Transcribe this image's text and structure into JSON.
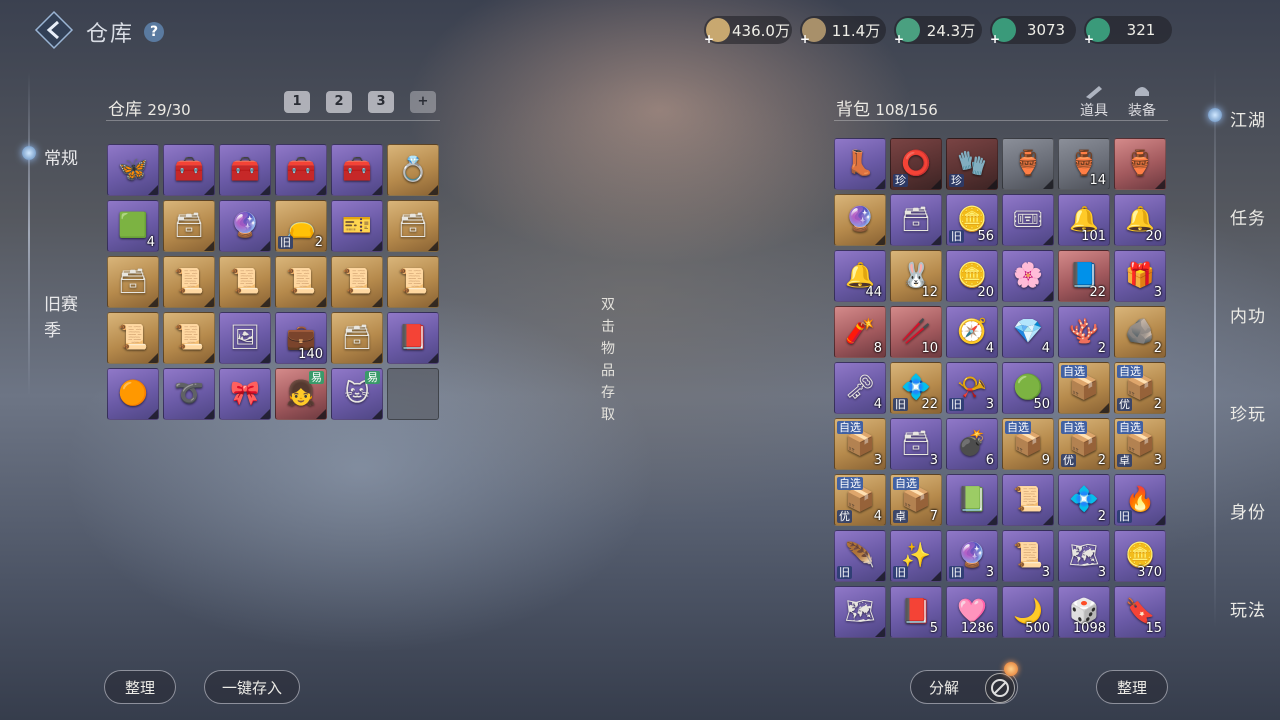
{
  "header": {
    "title": "仓库",
    "help_icon": "question-icon"
  },
  "currencies": [
    {
      "name": "scroll-currency-icon",
      "value": "436.0万",
      "color": "#c8a870"
    },
    {
      "name": "coin-currency-icon",
      "value": "11.4万",
      "color": "#a8906a"
    },
    {
      "name": "jade-currency-icon",
      "value": "24.3万",
      "color": "#4aa080"
    },
    {
      "name": "jade-gem-icon",
      "value": "3073",
      "color": "#3a9a7a"
    },
    {
      "name": "jade-token-icon",
      "value": "321",
      "color": "#3a9a7a"
    }
  ],
  "left_tabs": {
    "normal": "常规",
    "season": "旧赛季"
  },
  "warehouse": {
    "label": "仓库",
    "used": "29",
    "capacity": "30",
    "tabs": [
      "1",
      "2",
      "3",
      "+"
    ],
    "items": [
      {
        "rarity": "purple",
        "icon": "butterfly-icon",
        "glyph": "🦋",
        "qty": ""
      },
      {
        "rarity": "purple",
        "icon": "box-icon",
        "glyph": "🧰",
        "qty": ""
      },
      {
        "rarity": "purple",
        "icon": "box-icon",
        "glyph": "🧰",
        "qty": ""
      },
      {
        "rarity": "purple",
        "icon": "box-icon",
        "glyph": "🧰",
        "qty": ""
      },
      {
        "rarity": "purple",
        "icon": "box-icon",
        "glyph": "🧰",
        "qty": ""
      },
      {
        "rarity": "gold",
        "icon": "jade-ring-icon",
        "glyph": "💍",
        "qty": ""
      },
      {
        "rarity": "purple",
        "icon": "jade-block-icon",
        "glyph": "🟩",
        "qty": "4"
      },
      {
        "rarity": "gold",
        "icon": "chest-icon",
        "glyph": "🗃",
        "qty": ""
      },
      {
        "rarity": "purple",
        "icon": "orb-icon",
        "glyph": "🔮",
        "qty": ""
      },
      {
        "rarity": "gold",
        "icon": "pouch-icon",
        "glyph": "👝",
        "qty": "2",
        "tag": "旧"
      },
      {
        "rarity": "purple",
        "icon": "ticket-icon",
        "glyph": "🎫",
        "qty": ""
      },
      {
        "rarity": "gold",
        "icon": "chest-icon",
        "glyph": "🗃",
        "qty": ""
      },
      {
        "rarity": "gold",
        "icon": "chest-icon",
        "glyph": "🗃",
        "qty": ""
      },
      {
        "rarity": "gold",
        "icon": "parchment-icon",
        "glyph": "📜",
        "qty": ""
      },
      {
        "rarity": "gold",
        "icon": "parchment-icon",
        "glyph": "📜",
        "qty": ""
      },
      {
        "rarity": "gold",
        "icon": "parchment-icon",
        "glyph": "📜",
        "qty": ""
      },
      {
        "rarity": "gold",
        "icon": "parchment-icon",
        "glyph": "📜",
        "qty": ""
      },
      {
        "rarity": "gold",
        "icon": "parchment-icon",
        "glyph": "📜",
        "qty": ""
      },
      {
        "rarity": "gold",
        "icon": "parchment-icon",
        "glyph": "📜",
        "qty": ""
      },
      {
        "rarity": "gold",
        "icon": "parchment-icon",
        "glyph": "📜",
        "qty": ""
      },
      {
        "rarity": "purple",
        "icon": "photo-card-icon",
        "glyph": "🖼",
        "qty": ""
      },
      {
        "rarity": "purple",
        "icon": "treasure-chest-icon",
        "glyph": "💼",
        "qty": "140"
      },
      {
        "rarity": "gold",
        "icon": "chest-icon",
        "glyph": "🗃",
        "qty": ""
      },
      {
        "rarity": "purple",
        "icon": "red-box-icon",
        "glyph": "📕",
        "qty": ""
      },
      {
        "rarity": "purple",
        "icon": "amber-icon",
        "glyph": "🟠",
        "qty": ""
      },
      {
        "rarity": "purple",
        "icon": "red-cord-icon",
        "glyph": "➰",
        "qty": ""
      },
      {
        "rarity": "purple",
        "icon": "ribbon-icon",
        "glyph": "🎀",
        "qty": ""
      },
      {
        "rarity": "red",
        "icon": "character-portrait-icon",
        "glyph": "👧",
        "qty": "",
        "easy": "易"
      },
      {
        "rarity": "purple",
        "icon": "cat-portrait-icon",
        "glyph": "🐱",
        "qty": "",
        "easy": "易"
      },
      {
        "rarity": "empty",
        "icon": "empty-slot",
        "glyph": "",
        "qty": ""
      }
    ]
  },
  "hint": "双击物品存取",
  "backpack": {
    "label": "背包",
    "used": "108",
    "capacity": "156",
    "tabs": [
      {
        "label": "道具",
        "icon": "props-icon"
      },
      {
        "label": "装备",
        "icon": "equipment-icon"
      }
    ],
    "items": [
      {
        "rarity": "purple",
        "icon": "boots-icon",
        "glyph": "👢",
        "qty": ""
      },
      {
        "rarity": "darkred",
        "icon": "bracelet-icon",
        "glyph": "⭕",
        "qty": "",
        "tag": "珍"
      },
      {
        "rarity": "darkred",
        "icon": "gauntlet-icon",
        "glyph": "🧤",
        "qty": "",
        "tag": "珍"
      },
      {
        "rarity": "gray",
        "icon": "jar-icon",
        "glyph": "🏺",
        "qty": ""
      },
      {
        "rarity": "gray",
        "icon": "jar-icon",
        "glyph": "🏺",
        "qty": "14"
      },
      {
        "rarity": "red",
        "icon": "vase-icon",
        "glyph": "🏺",
        "qty": ""
      },
      {
        "rarity": "gold",
        "icon": "crystal-ball-icon",
        "glyph": "🔮",
        "qty": ""
      },
      {
        "rarity": "purple",
        "icon": "chest-icon",
        "glyph": "🗃",
        "qty": ""
      },
      {
        "rarity": "purple",
        "icon": "gold-ingot-icon",
        "glyph": "🪙",
        "qty": "56",
        "tag": "旧"
      },
      {
        "rarity": "purple",
        "icon": "gold-ticket-icon",
        "glyph": "🎟",
        "qty": ""
      },
      {
        "rarity": "purple",
        "icon": "gold-bell-icon",
        "glyph": "🔔",
        "qty": "101"
      },
      {
        "rarity": "purple",
        "icon": "red-bell-icon",
        "glyph": "🔔",
        "qty": "20"
      },
      {
        "rarity": "purple",
        "icon": "blue-bell-icon",
        "glyph": "🔔",
        "qty": "44"
      },
      {
        "rarity": "gold",
        "icon": "rabbit-token-icon",
        "glyph": "🐰",
        "qty": "12"
      },
      {
        "rarity": "purple",
        "icon": "gold-ring-icon",
        "glyph": "🪙",
        "qty": "20"
      },
      {
        "rarity": "purple",
        "icon": "purple-flower-icon",
        "glyph": "🌸",
        "qty": ""
      },
      {
        "rarity": "red",
        "icon": "blue-scroll-icon",
        "glyph": "📘",
        "qty": "22"
      },
      {
        "rarity": "purple",
        "icon": "red-gift-icon",
        "glyph": "🎁",
        "qty": "3"
      },
      {
        "rarity": "red",
        "icon": "firecracker-icon",
        "glyph": "🧨",
        "qty": "8"
      },
      {
        "rarity": "red",
        "icon": "red-tube-icon",
        "glyph": "🥢",
        "qty": "10"
      },
      {
        "rarity": "purple",
        "icon": "compass-icon",
        "glyph": "🧭",
        "qty": "4"
      },
      {
        "rarity": "purple",
        "icon": "crystal-icon",
        "glyph": "💎",
        "qty": "4"
      },
      {
        "rarity": "purple",
        "icon": "red-branch-icon",
        "glyph": "🪸",
        "qty": "2"
      },
      {
        "rarity": "gold",
        "icon": "ore-icon",
        "glyph": "🪨",
        "qty": "2"
      },
      {
        "rarity": "purple",
        "icon": "gold-key-icon",
        "glyph": "🗝",
        "qty": "4"
      },
      {
        "rarity": "gold",
        "icon": "teal-gem-icon",
        "glyph": "💠",
        "qty": "22",
        "tag": "旧"
      },
      {
        "rarity": "purple",
        "icon": "gold-horn-icon",
        "glyph": "📯",
        "qty": "3",
        "tag": "旧"
      },
      {
        "rarity": "purple",
        "icon": "green-orb-icon",
        "glyph": "🟢",
        "qty": "50"
      },
      {
        "rarity": "gold",
        "icon": "selection-box-icon",
        "glyph": "📦",
        "qty": "",
        "tag2": "自选"
      },
      {
        "rarity": "gold",
        "icon": "selection-box-icon",
        "glyph": "📦",
        "qty": "2",
        "tag2": "自选",
        "tag": "优"
      },
      {
        "rarity": "gold",
        "icon": "selection-box-icon",
        "glyph": "📦",
        "qty": "3",
        "tag2": "自选"
      },
      {
        "rarity": "purple",
        "icon": "chest-icon",
        "glyph": "🗃",
        "qty": "3"
      },
      {
        "rarity": "purple",
        "icon": "bomb-icon",
        "glyph": "💣",
        "qty": "6"
      },
      {
        "rarity": "gold",
        "icon": "selection-box-icon",
        "glyph": "📦",
        "qty": "9",
        "tag2": "自选"
      },
      {
        "rarity": "gold",
        "icon": "selection-box-icon",
        "glyph": "📦",
        "qty": "2",
        "tag2": "自选",
        "tag": "优"
      },
      {
        "rarity": "gold",
        "icon": "selection-box-icon",
        "glyph": "📦",
        "qty": "3",
        "tag2": "自选",
        "tag": "卓"
      },
      {
        "rarity": "gold",
        "icon": "selection-box-icon",
        "glyph": "📦",
        "qty": "4",
        "tag2": "自选",
        "tag": "优"
      },
      {
        "rarity": "gold",
        "icon": "selection-box-icon",
        "glyph": "📦",
        "qty": "7",
        "tag2": "自选",
        "tag": "卓"
      },
      {
        "rarity": "purple",
        "icon": "jade-scroll-icon",
        "glyph": "📗",
        "qty": ""
      },
      {
        "rarity": "purple",
        "icon": "parchment-icon",
        "glyph": "📜",
        "qty": ""
      },
      {
        "rarity": "purple",
        "icon": "cyan-gem-icon",
        "glyph": "💠",
        "qty": "2"
      },
      {
        "rarity": "purple",
        "icon": "flame-orb-icon",
        "glyph": "🔥",
        "qty": "",
        "tag": "旧"
      },
      {
        "rarity": "purple",
        "icon": "feather-icon",
        "glyph": "🪶",
        "qty": "",
        "tag": "旧"
      },
      {
        "rarity": "purple",
        "icon": "purple-sparkle-icon",
        "glyph": "✨",
        "qty": "",
        "tag": "旧"
      },
      {
        "rarity": "purple",
        "icon": "crystal-orb-icon",
        "glyph": "🔮",
        "qty": "3",
        "tag": "旧"
      },
      {
        "rarity": "purple",
        "icon": "scroll-icon",
        "glyph": "📜",
        "qty": "3"
      },
      {
        "rarity": "purple",
        "icon": "stone-map-icon",
        "glyph": "🗺",
        "qty": "3"
      },
      {
        "rarity": "purple",
        "icon": "gold-coin-icon",
        "glyph": "🪙",
        "qty": "370"
      },
      {
        "rarity": "purple",
        "icon": "map-icon",
        "glyph": "🗺",
        "qty": ""
      },
      {
        "rarity": "purple",
        "icon": "red-book-icon",
        "glyph": "📕",
        "qty": "5"
      },
      {
        "rarity": "purple",
        "icon": "pink-orb-icon",
        "glyph": "🩷",
        "qty": "1286"
      },
      {
        "rarity": "purple",
        "icon": "crescent-icon",
        "glyph": "🌙",
        "qty": "500"
      },
      {
        "rarity": "purple",
        "icon": "dice-token-icon",
        "glyph": "🎲",
        "qty": "1098"
      },
      {
        "rarity": "purple",
        "icon": "gold-tablet-icon",
        "glyph": "🔖",
        "qty": "15"
      }
    ]
  },
  "right_nav": [
    "江湖",
    "任务",
    "内功",
    "珍玩",
    "身份",
    "玩法"
  ],
  "buttons": {
    "sort_left": "整理",
    "deposit_all": "一键存入",
    "decompose": "分解",
    "sort_right": "整理"
  }
}
